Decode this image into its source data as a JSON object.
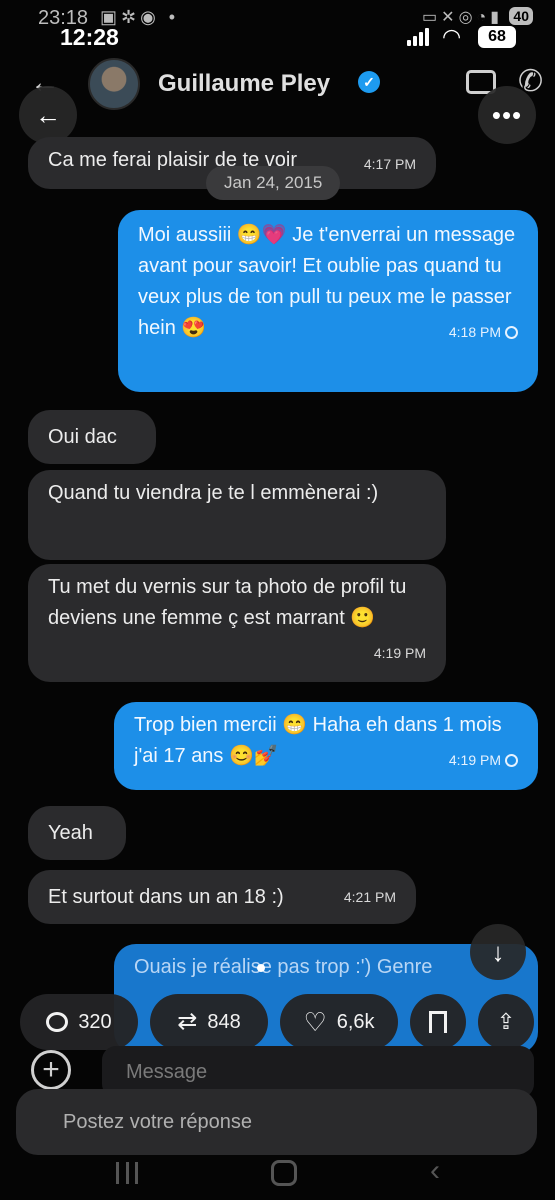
{
  "inner_status": {
    "time": "23:18",
    "battery": "40"
  },
  "outer_status": {
    "time": "12:28",
    "battery": "68"
  },
  "conversation": {
    "name": "Guillaume Pley"
  },
  "date_separator": "Jan 24, 2015",
  "messages": [
    {
      "side": "in",
      "text": "Ca me ferai plaisir de te voir",
      "time": "4:17 PM"
    },
    {
      "side": "out",
      "text": "Moi aussiii 😁💗 Je t'enverrai un message avant pour savoir! Et oublie pas quand tu veux plus de ton pull tu peux me le passer hein 😍",
      "time": "4:18 PM"
    },
    {
      "side": "in",
      "text": "Oui dac",
      "time": ""
    },
    {
      "side": "in",
      "text": "Quand tu viendra je te l emmènerai :)",
      "time": ""
    },
    {
      "side": "in",
      "text": "Tu met du vernis sur ta photo de profil tu deviens une femme ç est marrant 🙂",
      "time": "4:19 PM"
    },
    {
      "side": "out",
      "text": "Trop bien mercii 😁 Haha eh dans 1 mois j'ai 17 ans 😊💅",
      "time": "4:19 PM"
    },
    {
      "side": "in",
      "text": "Yeah",
      "time": ""
    },
    {
      "side": "in",
      "text": "Et surtout dans un an 18 :)",
      "time": "4:21 PM"
    },
    {
      "side": "out",
      "text": "Ouais je réalise pas trop :') Genre",
      "time": ""
    }
  ],
  "engagement": {
    "replies": "320",
    "reposts": "848",
    "likes": "6,6k"
  },
  "composer": {
    "placeholder": "Message"
  },
  "reply_box": {
    "placeholder": "Postez votre réponse"
  },
  "colors": {
    "outgoing": "#1d8fe8",
    "incoming": "#2b2b2d",
    "background": "#050505"
  }
}
